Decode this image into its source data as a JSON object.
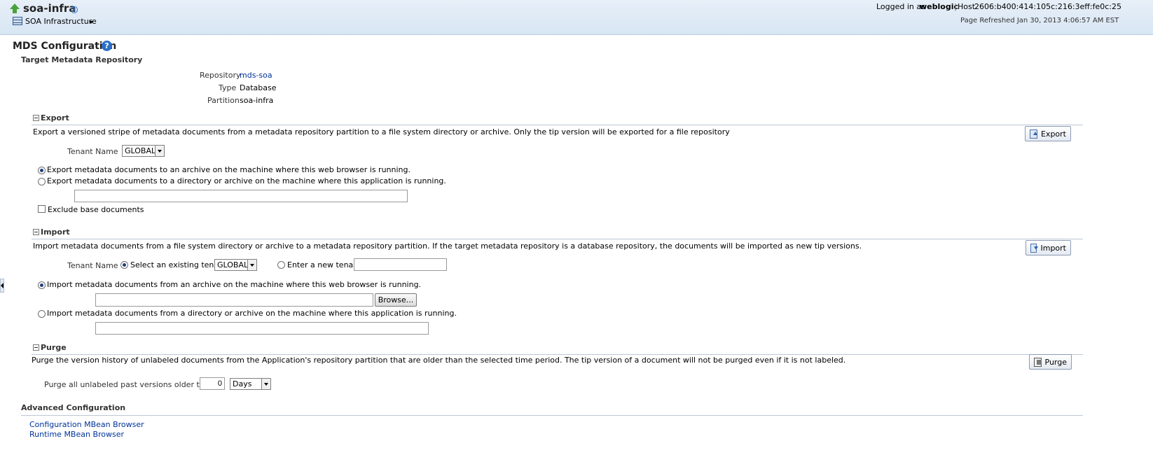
{
  "header": {
    "title": "soa-infra",
    "nav_menu": "SOA Infrastructure",
    "logged_in_prefix": "Logged in as",
    "username": "weblogic",
    "host_prefix": "Host",
    "host_value": "2606:b400:414:105c:216:3eff:fe0c:25",
    "page_refreshed": "Page Refreshed Jan 30, 2013 4:06:57 AM EST"
  },
  "page": {
    "title": "MDS Configuration",
    "help_glyph": "?",
    "info_glyph": "i"
  },
  "target": {
    "heading": "Target Metadata Repository",
    "repository_label": "Repository",
    "repository_value": "mds-soa",
    "type_label": "Type",
    "type_value": "Database",
    "partition_label": "Partition",
    "partition_value": "soa-infra"
  },
  "export": {
    "heading": "Export",
    "description": "Export a versioned stripe of metadata documents from a metadata repository partition to a file system directory or archive. Only the tip version will be exported for a file repository",
    "button": "Export",
    "tenant_label": "Tenant Name",
    "tenant_value": "GLOBAL",
    "option_browser": "Export metadata documents to an archive on the machine where this web browser is running.",
    "option_server": "Export metadata documents to a directory or archive on the machine where this application is running.",
    "path_value": "",
    "exclude_label": "Exclude base documents"
  },
  "import": {
    "heading": "Import",
    "description": "Import metadata documents from a file system directory or archive to a metadata repository partition. If the target metadata repository is a database repository, the documents will be imported as new tip versions.",
    "button": "Import",
    "tenant_label": "Tenant Name",
    "existing_label": "Select an existing tenant",
    "existing_value": "GLOBAL",
    "new_label": "Enter a new tenant",
    "new_value": "",
    "option_browser": "Import metadata documents from an archive on the machine where this web browser is running.",
    "file_value": "",
    "browse_button": "Browse...",
    "option_server": "Import metadata documents from a directory or archive on the machine where this application is running.",
    "server_path_value": ""
  },
  "purge": {
    "heading": "Purge",
    "description": "Purge the version history of unlabeled documents from the Application's repository partition that are older than the selected time period. The tip version of a document will not be purged even if it is not labeled.",
    "button": "Purge",
    "older_label": "Purge all unlabeled past versions older than :",
    "older_value": "0",
    "unit_value": "Days"
  },
  "advanced": {
    "heading": "Advanced Configuration",
    "link_config": "Configuration MBean Browser",
    "link_runtime": "Runtime MBean Browser"
  }
}
